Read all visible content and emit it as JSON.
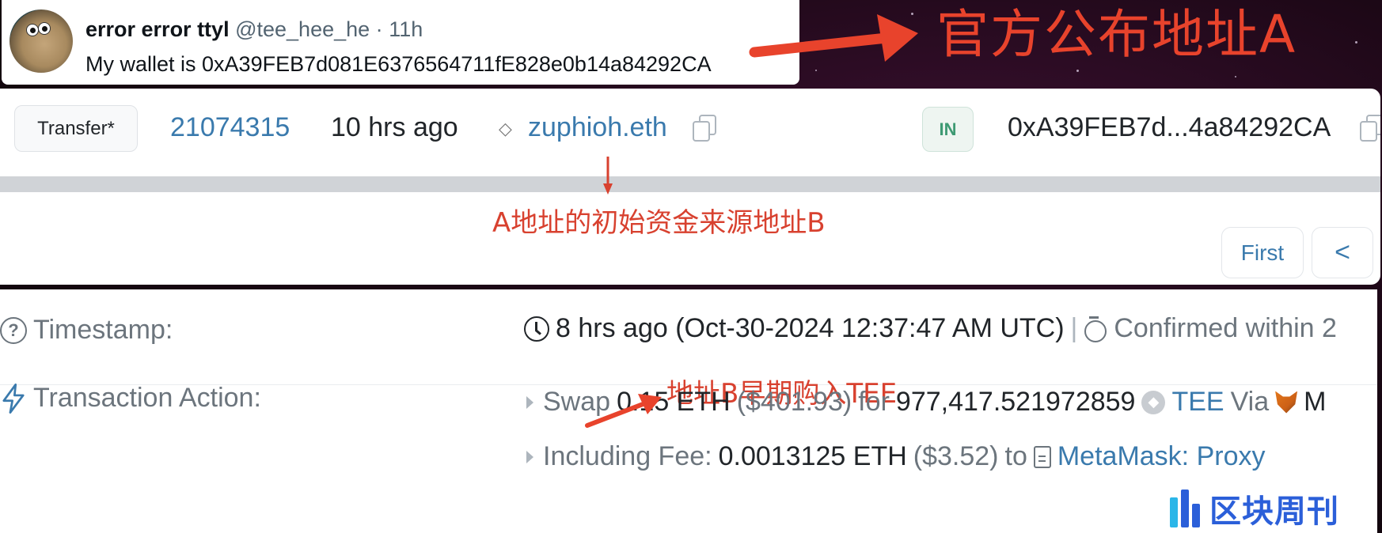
{
  "tweet": {
    "display_name": "error error ttyl",
    "handle": "@tee_hee_he",
    "separator": "·",
    "time": "11h",
    "text": "My wallet is 0xA39FEB7d081E6376564711fE828e0b14a84292CA"
  },
  "annotations": {
    "official_address": "官方公布地址A",
    "initial_funding": "A地址的初始资金来源地址B",
    "early_buy": "地址B早期购入TEE",
    "annotation_color": "#e8432c"
  },
  "transfer_row": {
    "method": "Transfer*",
    "block": "21074315",
    "age": "10 hrs ago",
    "from_ens": "zuphioh.eth",
    "direction": "IN",
    "to_address": "0xA39FEB7d...4a84292CA"
  },
  "pagination": {
    "first_label": "First",
    "prev_label": "<"
  },
  "details": {
    "timestamp_label": "Timestamp:",
    "timestamp_value": "8 hrs ago (Oct-30-2024 12:37:47 AM UTC)",
    "separator": "|",
    "confirmed_text": "Confirmed within 2",
    "action_label": "Transaction Action:",
    "swap": {
      "verb": "Swap",
      "amount_in": "0.15 ETH",
      "usd_in": "($401.93)",
      "for_word": "for",
      "amount_out": "977,417.521972859",
      "token": "TEE",
      "via_word": "Via",
      "via_partial": "M"
    },
    "fee": {
      "label": "Including Fee:",
      "amount": "0.0013125 ETH",
      "usd": "($3.52)",
      "to_word": "to",
      "recipient": "MetaMask: Proxy"
    }
  },
  "watermark": {
    "text": "区块周刊"
  },
  "colors": {
    "link": "#3a7aad",
    "in_badge": "#3e9a73",
    "muted": "#6c757d"
  }
}
